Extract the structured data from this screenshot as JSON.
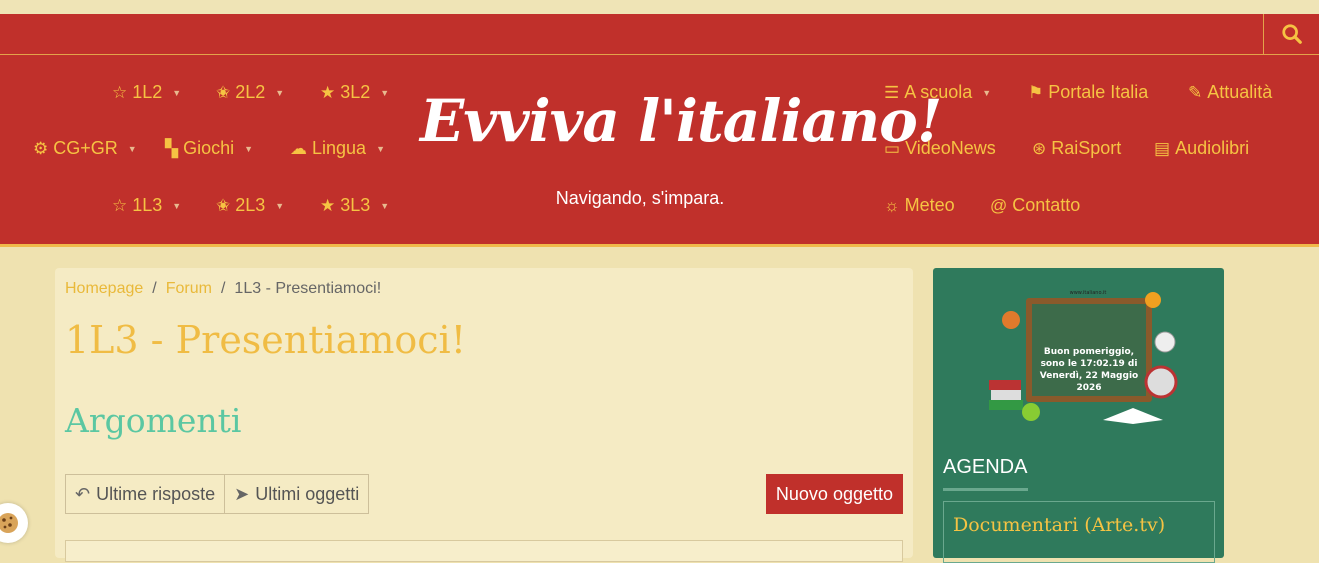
{
  "header": {
    "logo": "Evviva l'italiano!",
    "tagline": "Navigando, s'impara.",
    "nav_left": [
      {
        "label": "1L2",
        "icon": "star-outline-icon"
      },
      {
        "label": "2L2",
        "icon": "star-half-icon"
      },
      {
        "label": "3L2",
        "icon": "star-full-icon"
      },
      {
        "label": "CG+GR",
        "icon": "gear-icon"
      },
      {
        "label": "Giochi",
        "icon": "puzzle-icon"
      },
      {
        "label": "Lingua",
        "icon": "chat-bubbles-icon"
      },
      {
        "label": "1L3",
        "icon": "star-outline-icon"
      },
      {
        "label": "2L3",
        "icon": "star-half-icon"
      },
      {
        "label": "3L3",
        "icon": "star-full-icon"
      }
    ],
    "nav_right": [
      {
        "label": "A scuola",
        "icon": "school-icon"
      },
      {
        "label": "Portale Italia",
        "icon": "flag-icon"
      },
      {
        "label": "Attualità",
        "icon": "edit-icon"
      },
      {
        "label": "VideoNews",
        "icon": "monitor-icon"
      },
      {
        "label": "RaiSport",
        "icon": "ball-icon"
      },
      {
        "label": "Audiolibri",
        "icon": "book-open-icon"
      },
      {
        "label": "Meteo",
        "icon": "sun-icon"
      },
      {
        "label": "Contatto",
        "icon": "at-icon"
      }
    ]
  },
  "breadcrumb": {
    "home": "Homepage",
    "forum": "Forum",
    "current": "1L3 - Presentiamoci!"
  },
  "main": {
    "title": "1L3 - Presentiamoci!",
    "section": "Argomenti",
    "buttons": {
      "latest_replies": "Ultime risposte",
      "latest_topics": "Ultimi oggetti",
      "new_topic": "Nuovo oggetto"
    }
  },
  "sidebar": {
    "blackboard_text": "Buon pomeriggio, sono le 17:02.19 di Venerdì, 22 Maggio 2026",
    "blackboard_url": "www.italiano.it",
    "agenda_title": "AGENDA",
    "agenda_item": "Documentari (Arte.tv)"
  },
  "colors": {
    "header_red": "#c0302b",
    "accent_yellow": "#f6c343",
    "title_yellow": "#f0bc44",
    "section_green": "#5bc7a2",
    "sidebar_green": "#2f7a5c"
  }
}
